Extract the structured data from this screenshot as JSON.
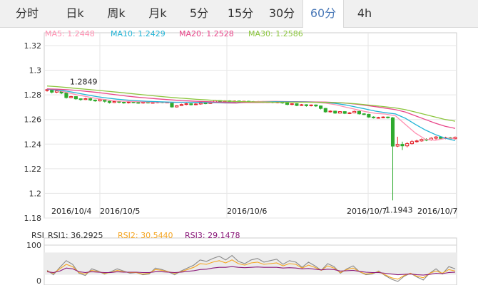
{
  "tabs": [
    {
      "label": "分时",
      "active": false
    },
    {
      "label": "日k",
      "active": false
    },
    {
      "label": "周k",
      "active": false
    },
    {
      "label": "月k",
      "active": false
    },
    {
      "label": "5分",
      "active": false
    },
    {
      "label": "15分",
      "active": false
    },
    {
      "label": "30分",
      "active": false
    },
    {
      "label": "60分",
      "active": true
    },
    {
      "label": "4h",
      "active": false
    }
  ],
  "legend": [
    {
      "label": "MA5: 1.2448",
      "color": "#ff8fb1"
    },
    {
      "label": "MA10: 1.2429",
      "color": "#22b4d6"
    },
    {
      "label": "MA20: 1.2528",
      "color": "#e8468a"
    },
    {
      "label": "MA30: 1.2586",
      "color": "#8cc63e"
    }
  ],
  "rsi_legend": [
    {
      "label": "RSI",
      "color": "#333333"
    },
    {
      "label": "RSI1: 36.2925",
      "color": "#333333"
    },
    {
      "label": "RSI2: 30.5440",
      "color": "#f5a623"
    },
    {
      "label": "RSI3: 29.1478",
      "color": "#8b1a7a"
    }
  ],
  "chart_data": {
    "type": "candlestick",
    "y_ticks": [
      "1.32",
      "1.3",
      "1.28",
      "1.26",
      "1.24",
      "1.22",
      "1.2",
      "1.18"
    ],
    "ylim": [
      1.18,
      1.32
    ],
    "x_labels": [
      "2016/10/4",
      "2016/10/5",
      "2016/10/6",
      "2016/10/7",
      "2016/10/7"
    ],
    "annotations": [
      {
        "text": "1.2849",
        "value": 1.2849
      },
      {
        "text": "1.1943",
        "value": 1.1943
      }
    ],
    "candles": [
      [
        1.2838,
        1.2842,
        1.2849,
        1.2826
      ],
      [
        1.2842,
        1.2822,
        1.2846,
        1.2812
      ],
      [
        1.2822,
        1.2832,
        1.2838,
        1.2815
      ],
      [
        1.2832,
        1.2815,
        1.2836,
        1.2806
      ],
      [
        1.2815,
        1.2778,
        1.282,
        1.277
      ],
      [
        1.2778,
        1.2786,
        1.2792,
        1.2772
      ],
      [
        1.2786,
        1.2768,
        1.279,
        1.276
      ],
      [
        1.2768,
        1.2762,
        1.2772,
        1.2752
      ],
      [
        1.2762,
        1.2769,
        1.2776,
        1.2758
      ],
      [
        1.2769,
        1.2758,
        1.2774,
        1.275
      ],
      [
        1.2758,
        1.2751,
        1.2762,
        1.2744
      ],
      [
        1.2751,
        1.2762,
        1.277,
        1.2746
      ],
      [
        1.2762,
        1.2748,
        1.2766,
        1.2738
      ],
      [
        1.2748,
        1.2738,
        1.2752,
        1.273
      ],
      [
        1.2738,
        1.2746,
        1.2752,
        1.2734
      ],
      [
        1.2746,
        1.274,
        1.275,
        1.2732
      ],
      [
        1.274,
        1.2736,
        1.2744,
        1.2728
      ],
      [
        1.2736,
        1.2742,
        1.2748,
        1.273
      ],
      [
        1.2742,
        1.2738,
        1.2746,
        1.2732
      ],
      [
        1.2738,
        1.2734,
        1.2742,
        1.2728
      ],
      [
        1.2734,
        1.274,
        1.2746,
        1.2728
      ],
      [
        1.274,
        1.2736,
        1.2744,
        1.273
      ],
      [
        1.2736,
        1.2738,
        1.2742,
        1.273
      ],
      [
        1.2738,
        1.2742,
        1.2748,
        1.2732
      ],
      [
        1.2742,
        1.2738,
        1.2746,
        1.2732
      ],
      [
        1.2738,
        1.274,
        1.2744,
        1.2732
      ],
      [
        1.274,
        1.2702,
        1.2742,
        1.2696
      ],
      [
        1.2702,
        1.2712,
        1.2716,
        1.2698
      ],
      [
        1.2712,
        1.2722,
        1.2728,
        1.2708
      ],
      [
        1.2722,
        1.2728,
        1.2734,
        1.2716
      ],
      [
        1.2728,
        1.272,
        1.2732,
        1.2714
      ],
      [
        1.272,
        1.2726,
        1.2732,
        1.2716
      ],
      [
        1.2726,
        1.2734,
        1.274,
        1.272
      ],
      [
        1.2734,
        1.273,
        1.2738,
        1.2724
      ],
      [
        1.273,
        1.2742,
        1.2748,
        1.2726
      ],
      [
        1.2742,
        1.2754,
        1.276,
        1.2738
      ],
      [
        1.2754,
        1.2744,
        1.2758,
        1.2738
      ],
      [
        1.2744,
        1.2752,
        1.2756,
        1.274
      ],
      [
        1.2752,
        1.2746,
        1.2756,
        1.274
      ],
      [
        1.2746,
        1.275,
        1.2754,
        1.2742
      ],
      [
        1.275,
        1.2744,
        1.2754,
        1.2738
      ],
      [
        1.2744,
        1.2748,
        1.2752,
        1.274
      ],
      [
        1.2748,
        1.2746,
        1.2752,
        1.274
      ],
      [
        1.2746,
        1.2742,
        1.275,
        1.2736
      ],
      [
        1.2742,
        1.2746,
        1.275,
        1.2738
      ],
      [
        1.2746,
        1.274,
        1.275,
        1.2734
      ],
      [
        1.274,
        1.2744,
        1.2748,
        1.2736
      ],
      [
        1.2744,
        1.2738,
        1.2748,
        1.2732
      ],
      [
        1.2738,
        1.2742,
        1.2746,
        1.2732
      ],
      [
        1.2742,
        1.2734,
        1.2746,
        1.2728
      ],
      [
        1.2734,
        1.2722,
        1.2738,
        1.2716
      ],
      [
        1.2722,
        1.2728,
        1.2732,
        1.2716
      ],
      [
        1.2728,
        1.2714,
        1.2732,
        1.2708
      ],
      [
        1.2714,
        1.272,
        1.2726,
        1.271
      ],
      [
        1.272,
        1.2712,
        1.2724,
        1.2704
      ],
      [
        1.2712,
        1.2718,
        1.2722,
        1.2706
      ],
      [
        1.2718,
        1.271,
        1.2722,
        1.2702
      ],
      [
        1.271,
        1.269,
        1.2714,
        1.2682
      ],
      [
        1.269,
        1.2662,
        1.2694,
        1.2656
      ],
      [
        1.2662,
        1.2668,
        1.2674,
        1.2656
      ],
      [
        1.2668,
        1.2652,
        1.2672,
        1.2646
      ],
      [
        1.2652,
        1.2664,
        1.2668,
        1.2648
      ],
      [
        1.2664,
        1.265,
        1.2668,
        1.2644
      ],
      [
        1.265,
        1.2654,
        1.266,
        1.2644
      ],
      [
        1.2654,
        1.2666,
        1.2672,
        1.265
      ],
      [
        1.2666,
        1.2646,
        1.267,
        1.264
      ],
      [
        1.2646,
        1.2642,
        1.2652,
        1.2636
      ],
      [
        1.2642,
        1.262,
        1.2646,
        1.2614
      ],
      [
        1.262,
        1.2614,
        1.2626,
        1.2608
      ],
      [
        1.2614,
        1.2616,
        1.2622,
        1.2608
      ],
      [
        1.2616,
        1.262,
        1.2626,
        1.261
      ],
      [
        1.262,
        1.2614,
        1.2624,
        1.2608
      ],
      [
        1.2614,
        1.2384,
        1.262,
        1.1943
      ],
      [
        1.2384,
        1.2398,
        1.246,
        1.2376
      ],
      [
        1.2398,
        1.2386,
        1.242,
        1.2352
      ],
      [
        1.2386,
        1.2404,
        1.2416,
        1.2374
      ],
      [
        1.2404,
        1.242,
        1.2432,
        1.2396
      ],
      [
        1.242,
        1.2426,
        1.2436,
        1.2412
      ],
      [
        1.2426,
        1.2438,
        1.2446,
        1.242
      ],
      [
        1.2438,
        1.2434,
        1.2448,
        1.2424
      ],
      [
        1.2434,
        1.2448,
        1.2456,
        1.2428
      ],
      [
        1.2448,
        1.2458,
        1.2466,
        1.2436
      ],
      [
        1.2458,
        1.2446,
        1.2464,
        1.2438
      ],
      [
        1.2446,
        1.2452,
        1.246,
        1.244
      ],
      [
        1.2452,
        1.2444,
        1.2458,
        1.2436
      ],
      [
        1.2444,
        1.2456,
        1.2462,
        1.2438
      ]
    ],
    "ma_series": [
      {
        "name": "MA5",
        "color": "#ff8fb1",
        "values": [
          1.285,
          1.2838,
          1.282,
          1.28,
          1.2785,
          1.277,
          1.276,
          1.275,
          1.2748,
          1.2745,
          1.2742,
          1.274,
          1.2738,
          1.2739,
          1.2741,
          1.274,
          1.2738,
          1.2736,
          1.2733,
          1.2732,
          1.2741,
          1.2745,
          1.2747,
          1.2748,
          1.2746,
          1.2744,
          1.2742,
          1.2738,
          1.2732,
          1.272,
          1.27,
          1.2682,
          1.2664,
          1.265,
          1.2644,
          1.263,
          1.256,
          1.249,
          1.244,
          1.2432,
          1.2446,
          1.2448
        ]
      },
      {
        "name": "MA10",
        "color": "#22b4d6",
        "values": [
          1.2846,
          1.284,
          1.283,
          1.2815,
          1.28,
          1.2786,
          1.2775,
          1.2765,
          1.2758,
          1.2752,
          1.2748,
          1.2745,
          1.2742,
          1.274,
          1.274,
          1.2739,
          1.2738,
          1.2737,
          1.2736,
          1.2735,
          1.2738,
          1.2741,
          1.2743,
          1.2745,
          1.2745,
          1.2745,
          1.2744,
          1.2742,
          1.2738,
          1.273,
          1.2718,
          1.2702,
          1.2685,
          1.2668,
          1.2655,
          1.2645,
          1.261,
          1.256,
          1.2515,
          1.2478,
          1.2448,
          1.2429
        ]
      },
      {
        "name": "MA20",
        "color": "#e8468a",
        "values": [
          1.2848,
          1.2846,
          1.2842,
          1.2836,
          1.2828,
          1.282,
          1.281,
          1.28,
          1.279,
          1.2782,
          1.2775,
          1.2768,
          1.2762,
          1.2756,
          1.2752,
          1.2748,
          1.2745,
          1.2742,
          1.274,
          1.2738,
          1.2738,
          1.2738,
          1.2739,
          1.274,
          1.2741,
          1.2742,
          1.2742,
          1.2742,
          1.2741,
          1.2738,
          1.2733,
          1.2725,
          1.2715,
          1.2704,
          1.2692,
          1.268,
          1.266,
          1.263,
          1.26,
          1.257,
          1.2545,
          1.2528
        ]
      },
      {
        "name": "MA30",
        "color": "#8cc63e",
        "values": [
          1.2872,
          1.2867,
          1.286,
          1.2852,
          1.2845,
          1.2838,
          1.283,
          1.2822,
          1.2814,
          1.2806,
          1.2798,
          1.279,
          1.2783,
          1.2776,
          1.277,
          1.2764,
          1.2759,
          1.2754,
          1.275,
          1.2746,
          1.2744,
          1.2742,
          1.2741,
          1.274,
          1.274,
          1.274,
          1.274,
          1.274,
          1.2739,
          1.2737,
          1.2734,
          1.2728,
          1.272,
          1.2712,
          1.2703,
          1.2694,
          1.268,
          1.266,
          1.264,
          1.262,
          1.26,
          1.2586
        ]
      }
    ],
    "rsi": {
      "ticks": [
        "100",
        "0"
      ],
      "ylim": [
        0,
        100
      ],
      "series": [
        {
          "name": "RSI1",
          "color": "#8a8a8a",
          "values": [
            32,
            20,
            40,
            58,
            48,
            24,
            18,
            36,
            30,
            22,
            28,
            36,
            30,
            24,
            26,
            20,
            22,
            38,
            34,
            28,
            20,
            30,
            38,
            46,
            60,
            56,
            64,
            70,
            60,
            72,
            56,
            50,
            60,
            64,
            54,
            58,
            62,
            48,
            58,
            54,
            40,
            54,
            44,
            32,
            50,
            42,
            24,
            36,
            44,
            28,
            20,
            22,
            30,
            18,
            8,
            2,
            16,
            24,
            14,
            6,
            24,
            36,
            22,
            42,
            36
          ]
        },
        {
          "name": "RSI2",
          "color": "#f5a623",
          "values": [
            30,
            24,
            36,
            48,
            42,
            26,
            22,
            32,
            28,
            24,
            26,
            32,
            28,
            26,
            26,
            22,
            24,
            34,
            32,
            28,
            24,
            28,
            34,
            40,
            50,
            48,
            54,
            58,
            52,
            60,
            50,
            46,
            52,
            54,
            48,
            50,
            52,
            44,
            50,
            48,
            38,
            46,
            40,
            32,
            44,
            38,
            26,
            34,
            38,
            28,
            22,
            24,
            28,
            20,
            12,
            8,
            18,
            24,
            16,
            12,
            24,
            30,
            24,
            34,
            30
          ]
        },
        {
          "name": "RSI3",
          "color": "#8b1a7a",
          "values": [
            28,
            26,
            30,
            38,
            36,
            28,
            26,
            28,
            27,
            26,
            26,
            28,
            27,
            27,
            27,
            26,
            26,
            28,
            28,
            27,
            26,
            27,
            29,
            31,
            34,
            35,
            38,
            40,
            40,
            42,
            40,
            39,
            40,
            41,
            40,
            40,
            40,
            38,
            39,
            38,
            36,
            37,
            35,
            33,
            35,
            34,
            30,
            31,
            32,
            29,
            27,
            26,
            26,
            24,
            22,
            20,
            21,
            22,
            20,
            19,
            21,
            24,
            23,
            26,
            27
          ]
        }
      ]
    }
  }
}
